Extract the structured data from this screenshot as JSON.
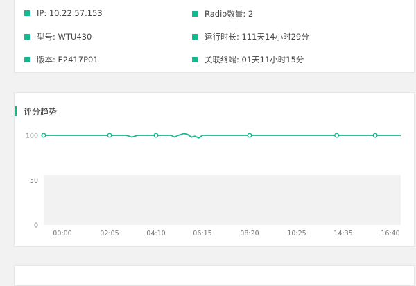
{
  "device_info": {
    "items": [
      {
        "label": "IP: 10.22.57.153"
      },
      {
        "label": "Radio数量: 2"
      },
      {
        "label": "型号: WTU430"
      },
      {
        "label": "运行时长: 111天14小时29分"
      },
      {
        "label": "版本: E2417P01"
      },
      {
        "label": "关联终端: 01天11小时15分"
      }
    ]
  },
  "score_trend": {
    "title": "评分趋势"
  },
  "colors": {
    "accent": "#14b88f",
    "plot_area": "#f2f2f2"
  },
  "chart_data": {
    "type": "line",
    "title": "评分趋势",
    "x_tick_labels": [
      "00:00",
      "02:05",
      "04:10",
      "06:15",
      "08:20",
      "10:25",
      "14:35",
      "16:40"
    ],
    "y_tick_labels": [
      "100",
      "50",
      "0"
    ],
    "ylim": [
      0,
      100
    ],
    "grid": false,
    "series": [
      {
        "x": [
          "00:00",
          "00:35",
          "01:10",
          "01:45",
          "02:05",
          "02:30",
          "02:50",
          "03:05",
          "03:20",
          "03:40",
          "04:10",
          "04:35",
          "04:50",
          "05:00",
          "05:10",
          "05:25",
          "05:35",
          "05:45",
          "05:55",
          "06:05",
          "06:15",
          "06:35",
          "07:20",
          "08:20",
          "09:30",
          "10:25",
          "11:40",
          "12:50",
          "14:00",
          "14:35",
          "15:20",
          "16:00",
          "16:40"
        ],
        "values": [
          100,
          100,
          100,
          100,
          100,
          100,
          100,
          98,
          100,
          100,
          100,
          100,
          100,
          98,
          100,
          102,
          101,
          98,
          99,
          97,
          100,
          100,
          100,
          100,
          100,
          100,
          100,
          100,
          100,
          100,
          100,
          100,
          100
        ],
        "markers": [
          "00:00",
          "02:05",
          "04:10",
          "08:20",
          "14:00",
          "16:00"
        ]
      }
    ]
  }
}
